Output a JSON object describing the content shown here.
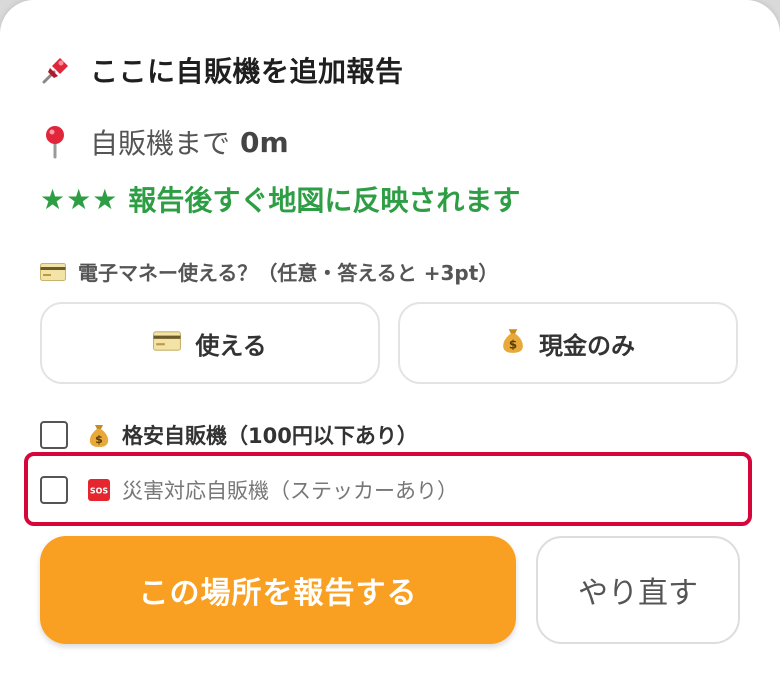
{
  "title": "ここに自販機を追加報告",
  "distance": {
    "label": "自販機まで",
    "value": "0m"
  },
  "status": {
    "stars": "★★★",
    "message": "報告後すぐ地図に反映されます"
  },
  "question": {
    "icon": "credit-card-icon",
    "text": "電子マネー使える？（任意・答えると +3pt）"
  },
  "choices": [
    {
      "icon": "credit-card-icon",
      "label": "使える"
    },
    {
      "icon": "money-bag-icon",
      "label": "現金のみ"
    }
  ],
  "options": [
    {
      "icon": "money-bag-icon",
      "label": "格安自販機（100円以下あり）",
      "checked": false
    },
    {
      "icon": "sos-icon",
      "label": "災害対応自販機（ステッカーあり）",
      "checked": false
    }
  ],
  "actions": {
    "submit": "この場所を報告する",
    "redo": "やり直す"
  },
  "colors": {
    "accent": "#f9a023",
    "success": "#2e9e44",
    "highlight": "#d4063a"
  }
}
